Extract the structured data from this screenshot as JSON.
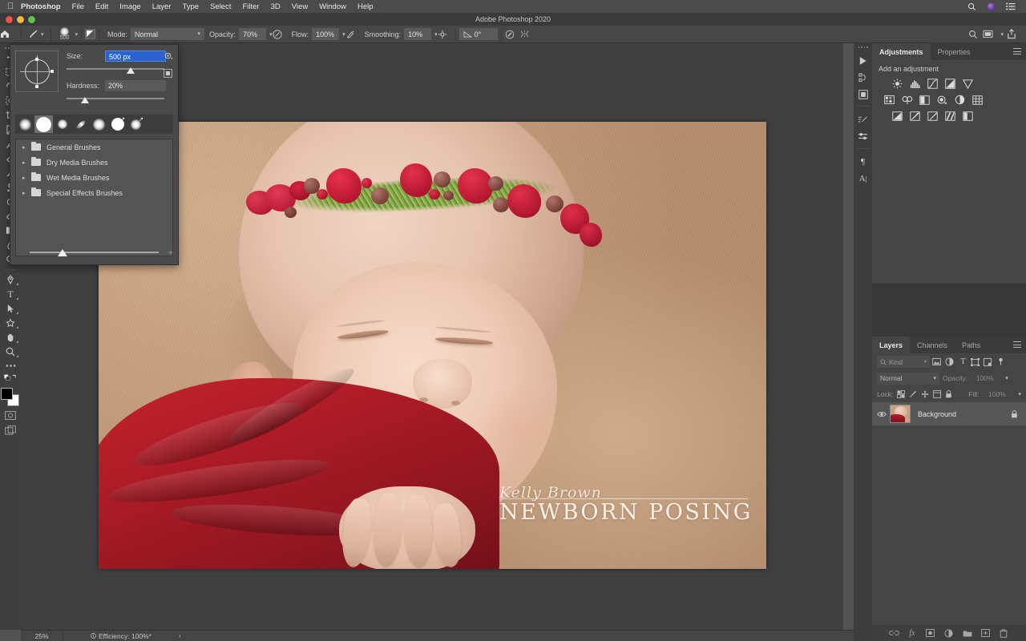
{
  "macos_menu": {
    "apple": "apple-logo",
    "items": [
      "Photoshop",
      "File",
      "Edit",
      "Image",
      "Layer",
      "Type",
      "Select",
      "Filter",
      "3D",
      "View",
      "Window",
      "Help"
    ],
    "right_icons": [
      "search-icon",
      "siri-icon",
      "control-center-icon"
    ]
  },
  "window": {
    "title": "Adobe Photoshop 2020",
    "close": "close-button",
    "minimize": "minimize-button",
    "maximize": "maximize-button"
  },
  "options_bar": {
    "home_icon": "home-icon",
    "tool_icon": "brush-tool-icon",
    "brush_size_label": "500",
    "toggle_brush_panel": "toggle-brush-settings-icon",
    "mode_label": "Mode:",
    "mode_value": "Normal",
    "opacity_label": "Opacity:",
    "opacity_value": "70%",
    "pressure_opacity_icon": "pressure-opacity-icon",
    "flow_label": "Flow:",
    "flow_value": "100%",
    "airbrush_icon": "airbrush-icon",
    "smoothing_label": "Smoothing:",
    "smoothing_value": "10%",
    "smoothing_options_icon": "gear-icon",
    "angle_label": "",
    "angle_value": "0°",
    "angle_icon": "angle-icon",
    "pressure_size_icon": "pressure-size-icon",
    "symmetry_icon": "symmetry-icon",
    "search_icon": "search-icon",
    "workspace_icon": "workspace-switcher-icon",
    "share_icon": "share-icon"
  },
  "toolbar": {
    "tools": [
      {
        "name": "move-tool",
        "glyph": "✥"
      },
      {
        "name": "marquee-tool",
        "glyph": "▭"
      },
      {
        "name": "lasso-tool",
        "glyph": "◠"
      },
      {
        "name": "object-selection-tool",
        "glyph": "⬚"
      },
      {
        "name": "crop-tool",
        "glyph": "⌗"
      },
      {
        "name": "frame-tool",
        "glyph": "▯"
      },
      {
        "name": "eyedropper-tool",
        "glyph": "⚲"
      },
      {
        "name": "healing-brush-tool",
        "glyph": "✎"
      },
      {
        "name": "brush-tool",
        "glyph": "🖌"
      },
      {
        "name": "clone-stamp-tool",
        "glyph": "⎙"
      },
      {
        "name": "history-brush-tool",
        "glyph": "↺"
      },
      {
        "name": "eraser-tool",
        "glyph": "◳"
      },
      {
        "name": "gradient-tool",
        "glyph": "▤"
      },
      {
        "name": "blur-tool",
        "glyph": "💧"
      },
      {
        "name": "dodge-tool",
        "glyph": "◐"
      },
      {
        "name": "pen-tool",
        "glyph": "✒"
      },
      {
        "name": "type-tool",
        "glyph": "T"
      },
      {
        "name": "path-selection-tool",
        "glyph": "➤"
      },
      {
        "name": "shape-tool",
        "glyph": "✿"
      },
      {
        "name": "hand-tool",
        "glyph": "✋"
      },
      {
        "name": "zoom-tool",
        "glyph": "🔍"
      },
      {
        "name": "edit-toolbar-tool",
        "glyph": "•••"
      }
    ],
    "foreground_color": "#000000",
    "background_color": "#ffffff",
    "quickmask_icon": "quick-mask-icon",
    "screenmode_icon": "screen-mode-icon"
  },
  "brush_panel": {
    "size_label": "Size:",
    "size_value": "500 px",
    "hardness_label": "Hardness:",
    "hardness_value": "20%",
    "gear_icon": "brush-settings-gear-icon",
    "new_preset_icon": "new-brush-preset-icon",
    "presets": [
      {
        "name": "soft-round-30",
        "selected": false
      },
      {
        "name": "soft-round-big",
        "selected": true
      },
      {
        "name": "soft-round-small",
        "selected": false
      },
      {
        "name": "flat-angled",
        "selected": false
      },
      {
        "name": "soft-round-pressure",
        "selected": false
      },
      {
        "name": "hard-round-pressure",
        "selected": false
      },
      {
        "name": "soft-round-pressure-opacity",
        "selected": false
      }
    ],
    "folders": [
      {
        "label": "General Brushes"
      },
      {
        "label": "Dry Media Brushes"
      },
      {
        "label": "Wet Media Brushes"
      },
      {
        "label": "Special Effects Brushes"
      }
    ]
  },
  "status_bar": {
    "zoom": "25%",
    "efficiency": "Efficiency: 100%*",
    "arrow": "›"
  },
  "dock_rail": {
    "icons": [
      {
        "name": "actions-icon",
        "glyph": "▶"
      },
      {
        "name": "history-icon",
        "glyph": "⎌"
      },
      {
        "name": "libraries-icon",
        "glyph": "▣"
      },
      {
        "name": "brush-settings-icon",
        "glyph": "✎"
      },
      {
        "name": "brushes-icon",
        "glyph": "⇄"
      },
      {
        "name": "paragraph-icon",
        "glyph": "¶"
      },
      {
        "name": "character-icon",
        "glyph": "A"
      }
    ]
  },
  "adjustments_panel": {
    "tabs": [
      {
        "label": "Adjustments",
        "active": true
      },
      {
        "label": "Properties",
        "active": false
      }
    ],
    "heading": "Add an adjustment",
    "rows": [
      [
        {
          "name": "brightness-contrast-icon",
          "glyph": "☀"
        },
        {
          "name": "levels-icon",
          "glyph": "▂▅▇"
        },
        {
          "name": "curves-icon",
          "glyph": "◪"
        },
        {
          "name": "exposure-icon",
          "glyph": "◫"
        },
        {
          "name": "vibrance-icon",
          "glyph": "▽"
        }
      ],
      [
        {
          "name": "hue-saturation-icon",
          "glyph": "▦"
        },
        {
          "name": "color-balance-icon",
          "glyph": "⚖"
        },
        {
          "name": "black-white-icon",
          "glyph": "◧"
        },
        {
          "name": "photo-filter-icon",
          "glyph": "◉"
        },
        {
          "name": "channel-mixer-icon",
          "glyph": "◕"
        },
        {
          "name": "color-lookup-icon",
          "glyph": "▩"
        }
      ],
      [
        {
          "name": "invert-icon",
          "glyph": "◩"
        },
        {
          "name": "posterize-icon",
          "glyph": "◨"
        },
        {
          "name": "threshold-icon",
          "glyph": "◪"
        },
        {
          "name": "gradient-map-icon",
          "glyph": "⧄"
        },
        {
          "name": "selective-color-icon",
          "glyph": "◐"
        }
      ]
    ]
  },
  "layers_panel": {
    "tabs": [
      {
        "label": "Layers",
        "active": true
      },
      {
        "label": "Channels",
        "active": false
      },
      {
        "label": "Paths",
        "active": false
      }
    ],
    "filter": {
      "search_icon": "search-icon",
      "kind_label": "Kind",
      "type_icons": [
        {
          "name": "filter-pixel-icon",
          "glyph": "▣"
        },
        {
          "name": "filter-adjustment-icon",
          "glyph": "◑"
        },
        {
          "name": "filter-type-icon",
          "glyph": "T"
        },
        {
          "name": "filter-shape-icon",
          "glyph": "⬚"
        },
        {
          "name": "filter-smart-object-icon",
          "glyph": "▨"
        }
      ],
      "toggle_icon": "filter-toggle-icon"
    },
    "blend_mode": "Normal",
    "opacity_label": "Opacity:",
    "opacity_value": "100%",
    "lock_label": "Lock:",
    "lock_icons": [
      {
        "name": "lock-transparency-icon",
        "glyph": "▩"
      },
      {
        "name": "lock-image-icon",
        "glyph": "🖌"
      },
      {
        "name": "lock-position-icon",
        "glyph": "✥"
      },
      {
        "name": "lock-artboard-icon",
        "glyph": "⬓"
      },
      {
        "name": "lock-all-icon",
        "glyph": "🔒"
      }
    ],
    "fill_label": "Fill:",
    "fill_value": "100%",
    "layers": [
      {
        "name": "Background",
        "visible": true,
        "locked": true
      }
    ],
    "footer_icons": [
      {
        "name": "link-layers-icon",
        "glyph": "∞"
      },
      {
        "name": "layer-style-icon",
        "glyph": "fx"
      },
      {
        "name": "layer-mask-icon",
        "glyph": "▣"
      },
      {
        "name": "new-fill-adjustment-icon",
        "glyph": "◑"
      },
      {
        "name": "new-group-icon",
        "glyph": "📁"
      },
      {
        "name": "new-layer-icon",
        "glyph": "⊞"
      },
      {
        "name": "delete-layer-icon",
        "glyph": "🗑"
      }
    ]
  },
  "canvas": {
    "watermark_script": "Kelly Brown",
    "watermark_title": "NEWBORN POSING",
    "image_description": "sleeping-newborn-with-floral-crown"
  },
  "colors": {
    "accent_blue": "#2a63d0",
    "panel_bg": "#454545",
    "app_bg": "#535353",
    "text": "#d2d2d2"
  }
}
